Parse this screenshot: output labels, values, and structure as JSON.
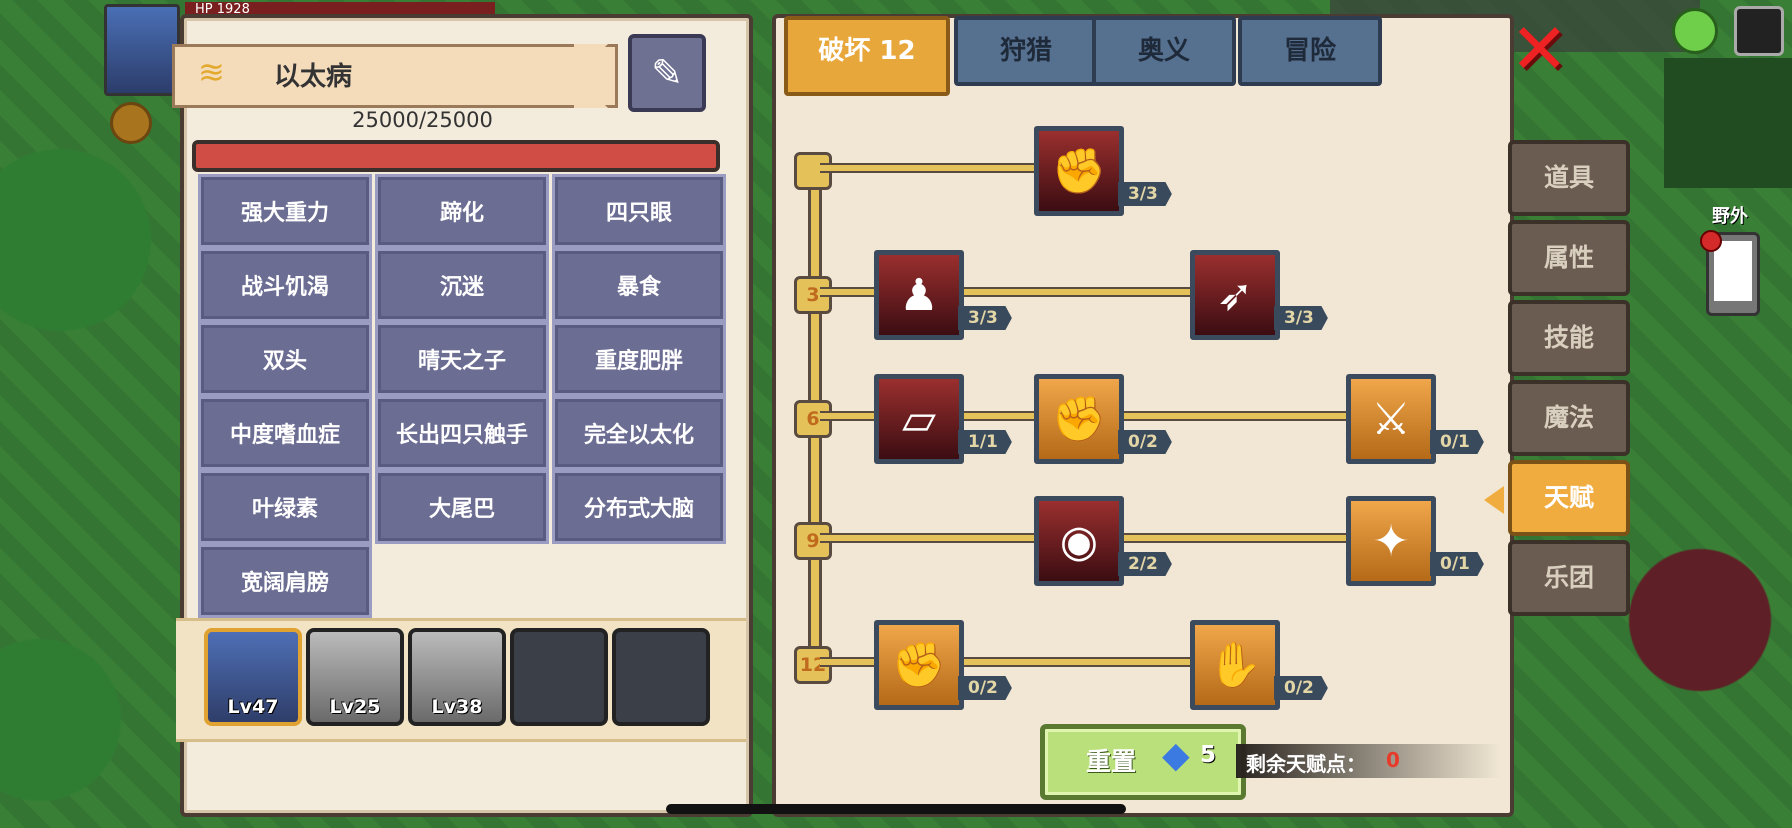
{
  "hud": {
    "hp_label": "HP",
    "hp_value": "1928",
    "area_label": "野外"
  },
  "mutation": {
    "name": "以太病",
    "hp": "25000/25000"
  },
  "traits": [
    "强大重力",
    "蹄化",
    "四只眼",
    "战斗饥渴",
    "沉迷",
    "暴食",
    "双头",
    "晴天之子",
    "重度肥胖",
    "中度嗜血症",
    "长出四只触手",
    "完全以太化",
    "叶绿素",
    "大尾巴",
    "分布式大脑",
    "宽阔肩膀"
  ],
  "team": [
    {
      "level": "Lv47",
      "state": "active"
    },
    {
      "level": "Lv25",
      "state": "gray"
    },
    {
      "level": "Lv38",
      "state": "gray"
    },
    {
      "level": "",
      "state": "empty"
    },
    {
      "level": "",
      "state": "empty"
    }
  ],
  "tabs": [
    {
      "label": "破坏 12",
      "active": true
    },
    {
      "label": "狩猎",
      "active": false
    },
    {
      "label": "奥义",
      "active": false
    },
    {
      "label": "冒险",
      "active": false
    }
  ],
  "tiers": [
    "",
    "3",
    "6",
    "9",
    "12"
  ],
  "skills": [
    {
      "icon": "arm-wrestle-icon",
      "glyph": "✊",
      "count": "3/3",
      "style": "red"
    },
    {
      "icon": "muscle-body-icon",
      "glyph": "♟",
      "count": "3/3",
      "style": "red"
    },
    {
      "icon": "piercing-arrow-icon",
      "glyph": "➶",
      "count": "3/3",
      "style": "red"
    },
    {
      "icon": "card-draw-icon",
      "glyph": "▱",
      "count": "1/1",
      "style": "red"
    },
    {
      "icon": "punch-icon",
      "glyph": "✊",
      "count": "0/2",
      "style": "orange"
    },
    {
      "icon": "slash-icon",
      "glyph": "⚔",
      "count": "0/1",
      "style": "orange"
    },
    {
      "icon": "orb-ring-icon",
      "glyph": "◉",
      "count": "2/2",
      "style": "red"
    },
    {
      "icon": "bat-wing-icon",
      "glyph": "✦",
      "count": "0/1",
      "style": "orange"
    },
    {
      "icon": "fist-icon",
      "glyph": "✊",
      "count": "0/2",
      "style": "orange"
    },
    {
      "icon": "palm-strike-icon",
      "glyph": "✋",
      "count": "0/2",
      "style": "orange"
    }
  ],
  "reset": {
    "label": "重置",
    "cost": "5"
  },
  "remaining": {
    "label": "剩余天赋点：",
    "value": "0"
  },
  "side_menu": [
    {
      "label": "道具",
      "active": false
    },
    {
      "label": "属性",
      "active": false
    },
    {
      "label": "技能",
      "active": false
    },
    {
      "label": "魔法",
      "active": false
    },
    {
      "label": "天赋",
      "active": true
    },
    {
      "label": "乐团",
      "active": false
    }
  ],
  "colors": {
    "accent": "#e8a73b",
    "hp_bar": "#d04d45",
    "trait": "#6c6d93",
    "reset_button": "#b9e07a",
    "remaining_value": "#e83a2a"
  }
}
